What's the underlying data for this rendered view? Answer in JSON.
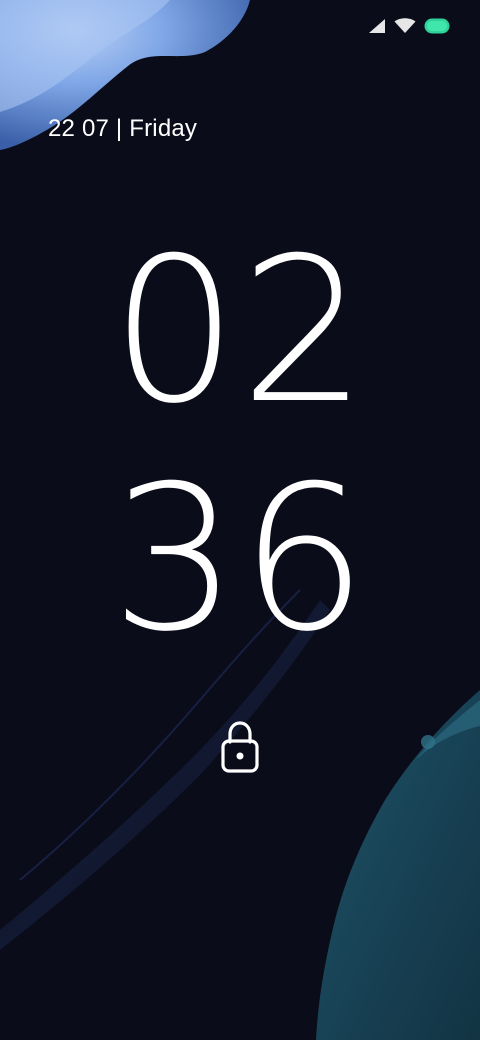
{
  "lock_screen": {
    "date": "22 07 | Friday",
    "clock": {
      "hours": "02",
      "minutes": "36"
    }
  },
  "status_bar": {
    "icons": [
      "cell-signal-icon",
      "wifi-icon",
      "battery-icon"
    ],
    "battery_color": "#2fd39a"
  },
  "icons": {
    "lock": "lock-icon"
  },
  "colors": {
    "background": "#0b0c19",
    "text": "#ffffff",
    "accent_blue": "#8fb3f0",
    "accent_teal": "#1d4a5c"
  }
}
